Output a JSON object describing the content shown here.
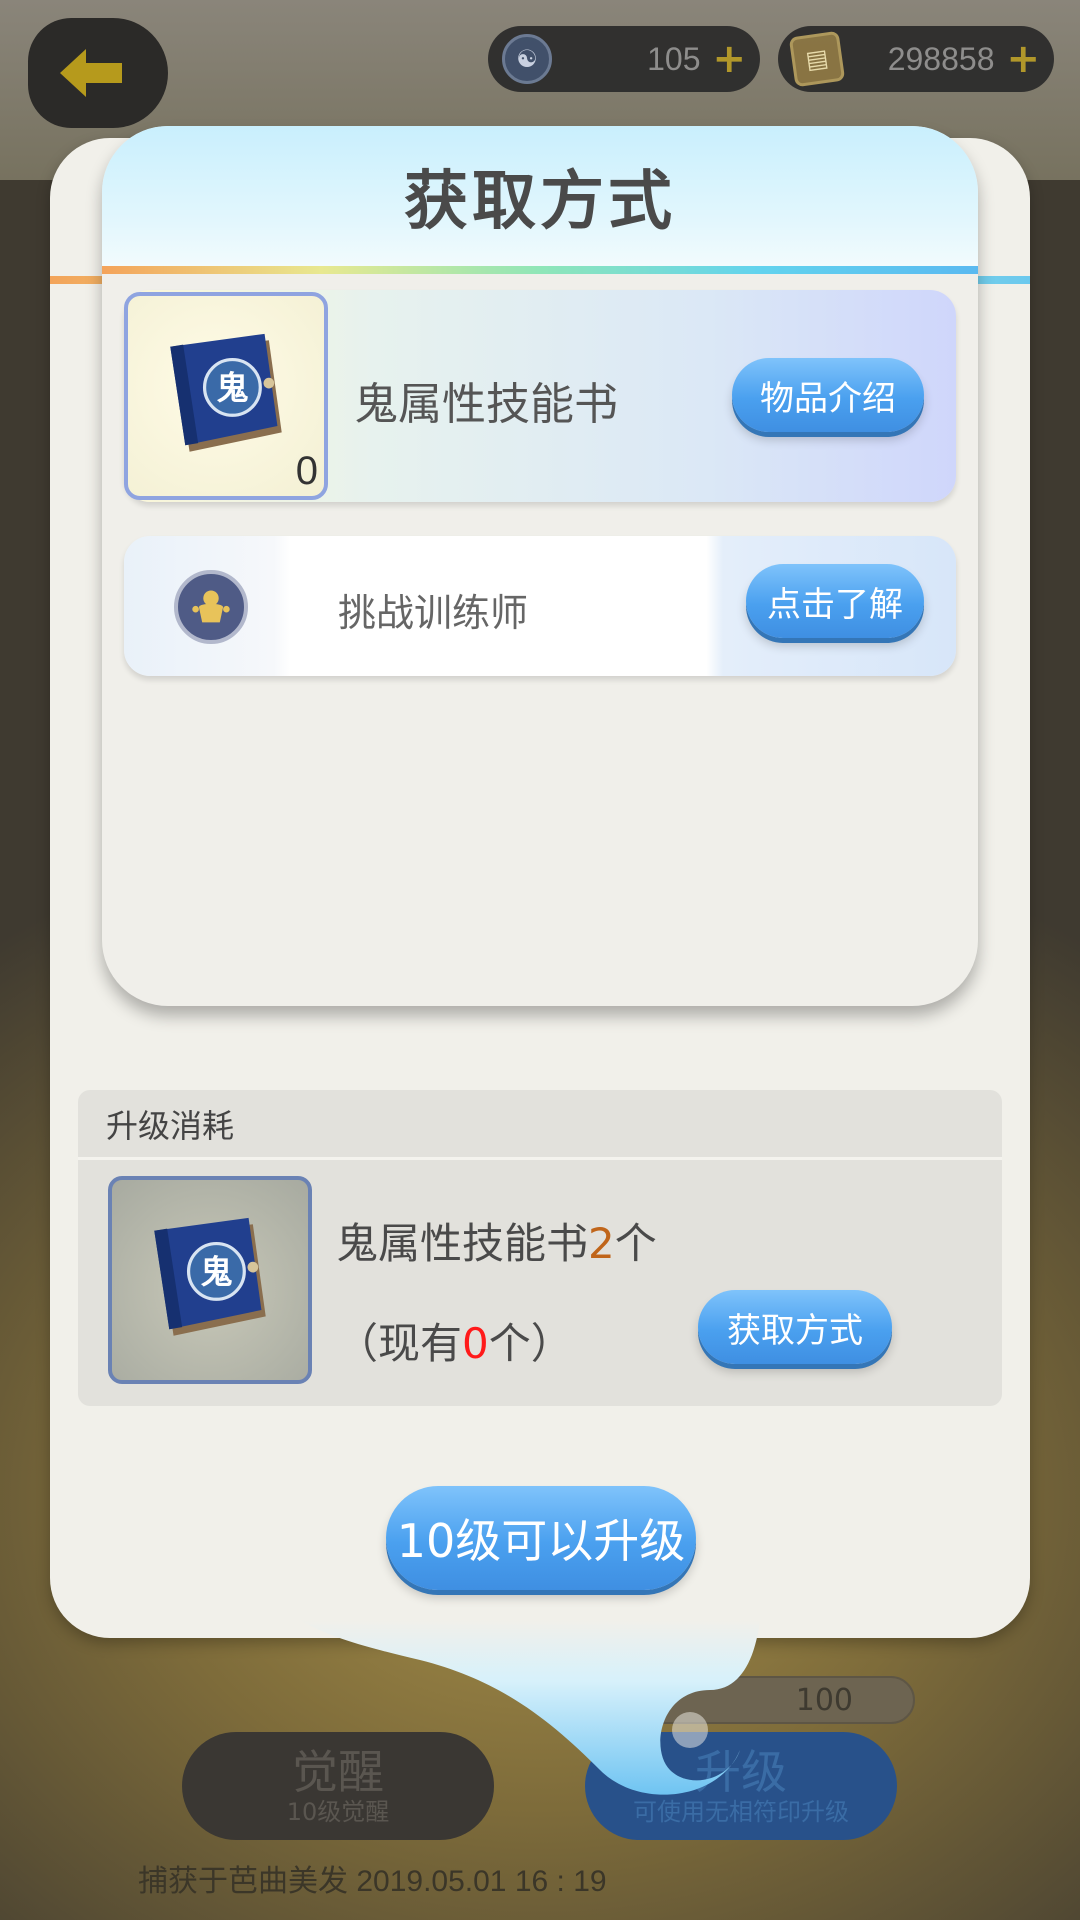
{
  "top_bar": {
    "soul_currency": "105",
    "gold_currency": "298858"
  },
  "popup": {
    "title": "获取方式",
    "item": {
      "name": "鬼属性技能书",
      "count": "0",
      "intro_button": "物品介绍"
    },
    "source": {
      "label": "挑战训练师",
      "learn_button": "点击了解"
    }
  },
  "upgrade_panel": {
    "cost_header": "升级消耗",
    "cost_item_name": "鬼属性技能书",
    "cost_item_amount": "2",
    "cost_item_unit": "个",
    "have_prefix": "（现有",
    "have_count": "0",
    "have_suffix": "个）",
    "get_method_button": "获取方式",
    "level_button": "10级可以升级"
  },
  "background": {
    "cost_value": "100",
    "awaken_label": "觉醒",
    "awaken_sub": "10级觉醒",
    "upgrade_label": "升级",
    "upgrade_sub": "可使用无相符印升级",
    "capture_text": "捕获于芭曲美发  2019.05.01   16 : 19"
  },
  "colors": {
    "button_blue": "#4aa0ef",
    "count_orange": "#c0651a",
    "have_red": "#ff1a1a"
  },
  "icons": [
    "back-arrow-icon",
    "soul-coin-icon",
    "gold-coin-icon",
    "plus-icon",
    "ghost-skill-book-icon",
    "trainer-icon"
  ]
}
